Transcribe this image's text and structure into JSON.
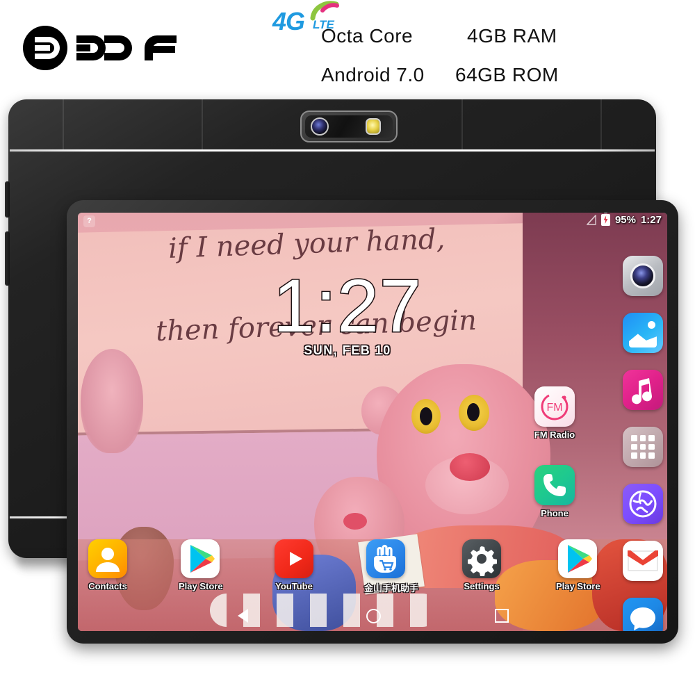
{
  "header": {
    "brand": "BDF",
    "lte": {
      "g": "4G",
      "lte": "LTE"
    },
    "specs": {
      "cpu": "Octa Core",
      "ram": "4GB RAM",
      "os": "Android 7.0",
      "rom": "64GB ROM"
    }
  },
  "device": {
    "camera_module": "rear-camera",
    "buttons": [
      "volume-up",
      "volume-down",
      "power",
      "side-key"
    ]
  },
  "screen": {
    "status_bar": {
      "left_icon": "?",
      "signal": "no-signal-icon",
      "battery_icon": "battery-charging-icon",
      "battery_percent": "95%",
      "time": "1:27"
    },
    "clock_widget": {
      "time": "1:27",
      "date": "SUN, FEB 10"
    },
    "wallpaper": {
      "script_line_1": "if I need your hand,",
      "script_line_2": "then forever can begin"
    },
    "rail_icons": [
      {
        "name": "camera",
        "class": "t-camera"
      },
      {
        "name": "gallery",
        "class": "t-gallery"
      },
      {
        "name": "music",
        "class": "t-music"
      },
      {
        "name": "app-drawer",
        "class": "t-drawer"
      },
      {
        "name": "browser",
        "class": "t-browser"
      },
      {
        "name": "gmail",
        "class": "t-gmail"
      },
      {
        "name": "messages",
        "class": "t-message"
      }
    ],
    "floating_apps": [
      {
        "name": "fm-radio",
        "label": "FM Radio"
      },
      {
        "name": "phone",
        "label": "Phone"
      }
    ],
    "dock_apps": [
      {
        "name": "contacts",
        "label": "Contacts"
      },
      {
        "name": "play-store",
        "label": "Play Store"
      },
      {
        "name": "youtube",
        "label": "YouTube"
      },
      {
        "name": "jinshan",
        "label": "金山手机助手"
      },
      {
        "name": "settings",
        "label": "Settings"
      },
      {
        "name": "play-store-2",
        "label": "Play Store"
      }
    ],
    "nav_bar": [
      "back",
      "home",
      "recent-apps"
    ]
  },
  "colors": {
    "lte_blue": "#1f9ae0",
    "lte_green": "#8dc63f",
    "lte_pink": "#e5317f",
    "body_black": "#1b1b1b",
    "text_black": "#121212"
  }
}
